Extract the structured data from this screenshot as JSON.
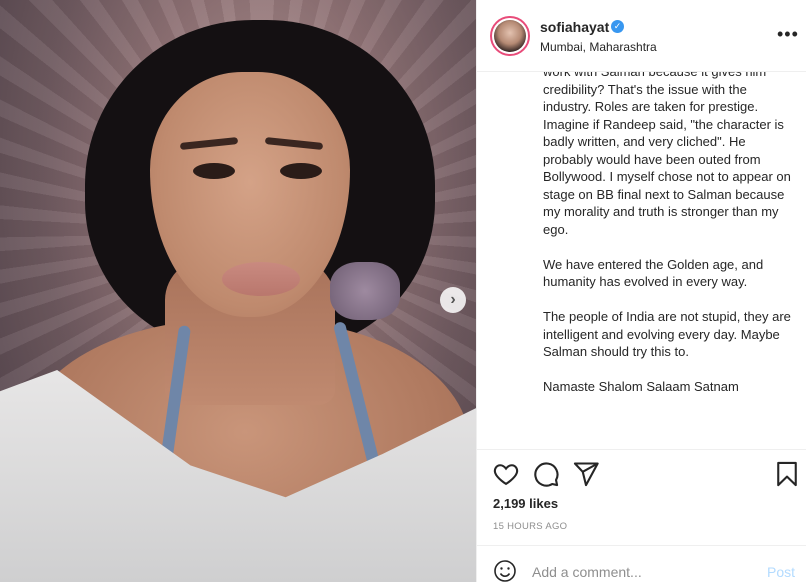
{
  "post": {
    "username": "sofiahayat",
    "verified_glyph": "✓",
    "location": "Mumbai, Maharashtra",
    "more_glyph": "•••",
    "next_glyph": "›",
    "caption_paragraphs": [
      "work with Salman because it gives him credibility? That's the issue with the industry. Roles are taken for prestige. Imagine if Randeep said, \"the character is badly written, and very cliched\". He probably would have been outed from Bollywood. I myself chose not to appear on stage on BB final next to Salman because my morality and truth is stronger than my ego.",
      "We have entered the Golden age, and humanity has evolved in every way.",
      "The people of India are not stupid, they are intelligent and evolving every day. Maybe Salman should try this to.",
      "Namaste Shalom Salaam Satnam"
    ],
    "likes": "2,199 likes",
    "time": "15 HOURS AGO"
  },
  "comment": {
    "placeholder": "Add a comment...",
    "post_label": "Post"
  },
  "icons": {
    "like": "heart-icon",
    "comment": "comment-icon",
    "share": "paper-plane-icon",
    "save": "bookmark-icon",
    "emoji": "smiley-icon",
    "next": "chevron-right-icon",
    "more": "ellipsis-icon",
    "verified": "verified-badge-icon"
  },
  "colors": {
    "verified": "#3897f0",
    "post_button": "#b3dbff",
    "avatar_ring": "#e84c7a",
    "muted_text": "#8e8e8e"
  }
}
